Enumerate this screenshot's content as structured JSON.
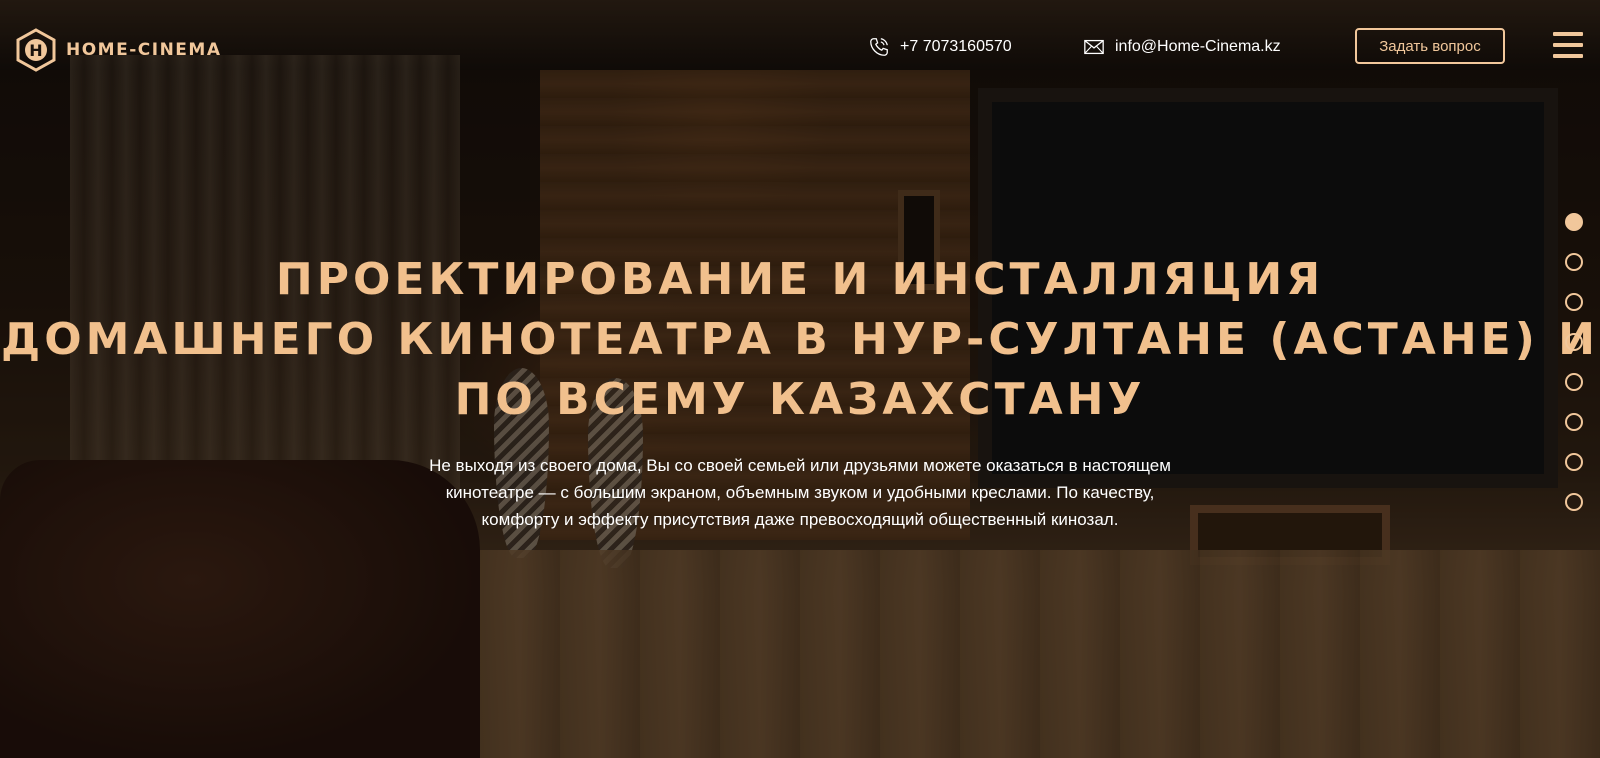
{
  "header": {
    "logo_text": "HOME-CINEMA",
    "logo_letter": "H",
    "phone": "+7 7073160570",
    "email": "info@Home-Cinema.kz",
    "ask_button": "Задать вопрос"
  },
  "hero": {
    "title_lines": [
      "ПРОЕКТИРОВАНИЕ И ИНСТАЛЛЯЦИЯ",
      "ДОМАШНЕГО КИНОТЕАТРА В НУР-СУЛТАНЕ (АСТАНЕ) И",
      "ПО ВСЕМУ КАЗАХСТАНУ"
    ],
    "subtext_lines": [
      "Не выходя из своего дома, Вы со своей семьей или друзьями можете оказаться в настоящем",
      "кинотеатре — с большим экраном, объемным звуком и удобными креслами. По качеству,",
      "комфорту и эффекту присутствия даже превосходящий общественный кинозал."
    ]
  },
  "pager": {
    "total": 8,
    "active_index": 0
  },
  "colors": {
    "accent": "#f1c79b",
    "text": "#ffffff"
  },
  "icons": [
    "logo-hexagon-icon",
    "phone-icon",
    "mail-icon",
    "hamburger-menu-icon"
  ]
}
